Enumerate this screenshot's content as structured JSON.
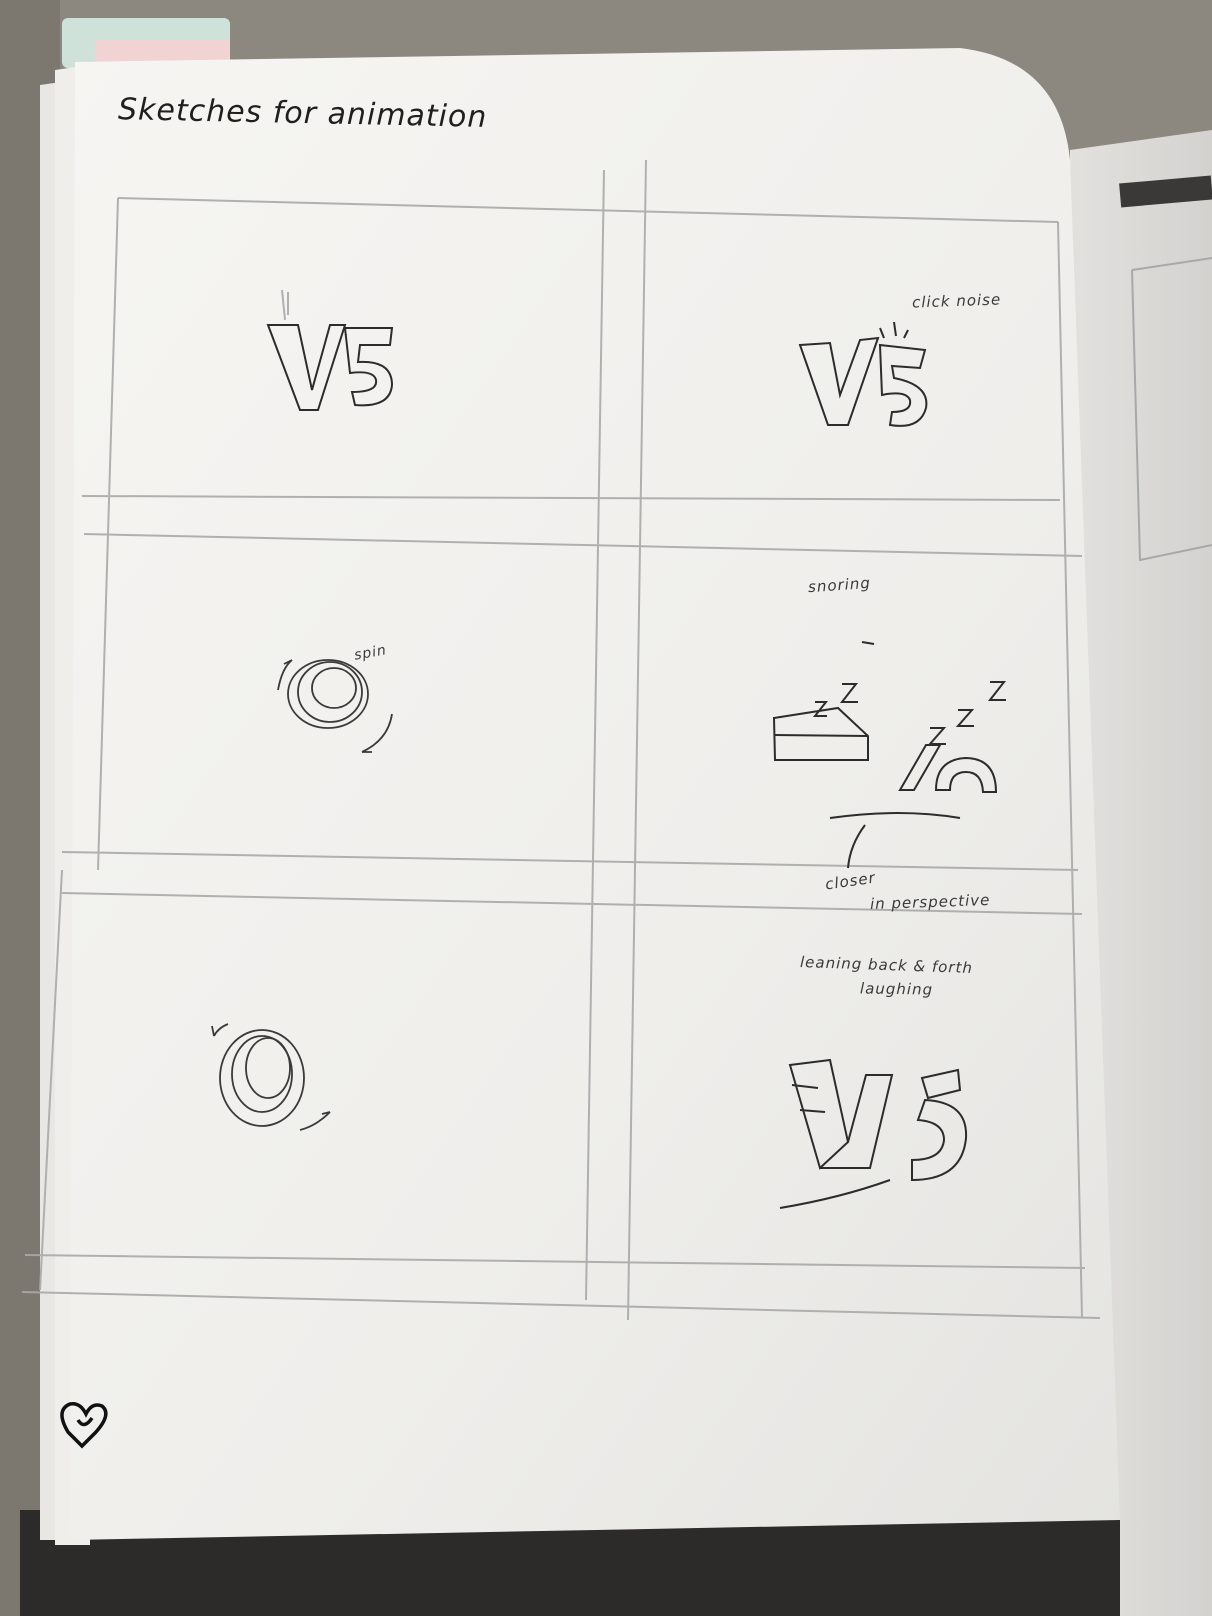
{
  "title": "Sketches for animation",
  "panels": [
    {
      "id": "panel-1",
      "text": "V5"
    },
    {
      "id": "panel-2",
      "text": "V5",
      "note": "click noise"
    },
    {
      "id": "panel-3",
      "note": "spin"
    },
    {
      "id": "panel-4",
      "note": "snoring",
      "note2": "closer",
      "note3": "in perspective"
    },
    {
      "id": "panel-5"
    },
    {
      "id": "panel-6",
      "text": "V5",
      "note": "leaning back & forth",
      "note2": "laughing"
    }
  ],
  "colors": {
    "background": "#8f8a82",
    "paper": "#f3f2ef",
    "pencil": "#9a9a9a",
    "ink": "#1f1f1f"
  },
  "icons": [
    "heart-icon"
  ]
}
